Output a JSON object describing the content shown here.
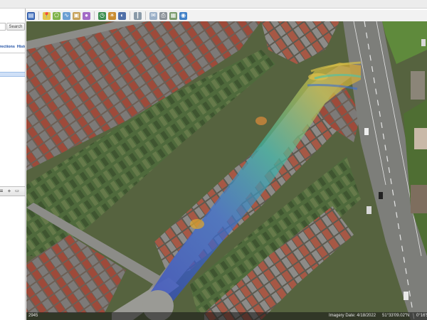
{
  "sidebar": {
    "search_input": "",
    "search_button": "Search",
    "tabs": [
      "Directions",
      "History"
    ]
  },
  "toolbar": {
    "icons": [
      "sidebar-toggle-icon",
      "placemark-icon",
      "polygon-icon",
      "path-icon",
      "image-overlay-icon",
      "record-tour-icon",
      "historical-imagery-icon",
      "sun-icon",
      "planets-icon",
      "ruler-icon",
      "email-icon",
      "print-icon",
      "save-image-icon",
      "maps-icon"
    ]
  },
  "map": {
    "status_left": "2945",
    "imagery_date": "Imagery Date: 4/18/2022",
    "coordinates": "51°33'09.02\"N",
    "elevation": "0°16'5"
  },
  "colors": {
    "heat_low": "#2f47c9",
    "heat_mid": "#3fb6a5",
    "heat_high": "#d9a431",
    "road": "#8c8c88",
    "roof_red": "#9e4a3a"
  }
}
